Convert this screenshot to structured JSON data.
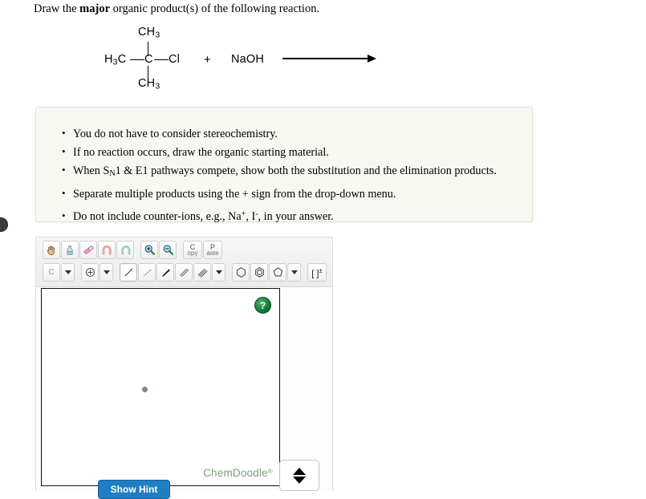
{
  "prompt": {
    "lead": "Draw the ",
    "bold": "major",
    "rest": " organic product(s) of the following reaction."
  },
  "reaction": {
    "left_methyl": "H3C",
    "center_atom": "C",
    "leaving_group": "Cl",
    "top_methyl": "CH3",
    "bottom_methyl": "CH3",
    "plus": "+",
    "reagent": "NaOH",
    "arrow_label": "",
    "structure_name": "2-chloro-2-methylpropane (tert-butyl chloride)"
  },
  "instructions": {
    "items": [
      "You do not have to consider stereochemistry.",
      "If no reaction occurs, draw the organic starting material.",
      "When SN1 & E1 pathways compete, show both the substitution and the elimination products.",
      "Separate multiple products using the + sign from the drop-down menu.",
      "Do not include counter-ions, e.g., Na+, I-, in your answer."
    ],
    "item3_parts": {
      "a": "When S",
      "sub": "N",
      "b": "1 & E1 pathways compete, show both the substitution and the elimination products."
    },
    "item5_parts": {
      "a": "Do not include counter-ions, e.g., Na",
      "sup1": "+",
      "b": ", I",
      "sup2": "-",
      "c": ", in your answer."
    }
  },
  "sketcher": {
    "toolbar_row1": [
      {
        "name": "hand-tool",
        "title": "Move / Pan"
      },
      {
        "name": "clear-tool",
        "title": "Clear"
      },
      {
        "name": "eraser-tool",
        "title": "Erase"
      },
      {
        "name": "undo-tool",
        "title": "Undo"
      },
      {
        "name": "redo-tool",
        "title": "Redo"
      },
      {
        "name": "zoom-in-tool",
        "title": "Zoom In"
      },
      {
        "name": "zoom-out-tool",
        "title": "Zoom Out"
      },
      {
        "name": "copy-tool",
        "title": "Copy"
      },
      {
        "name": "paste-tool",
        "title": "Paste"
      }
    ],
    "copy_label_top": "C",
    "copy_label_bottom": "opy",
    "paste_label_top": "P",
    "paste_label_bottom": "aste",
    "element_label": "C",
    "toolbar_row2": [
      {
        "name": "element-carbon-tool",
        "title": "Carbon"
      },
      {
        "name": "element-dropdown",
        "title": "More elements"
      },
      {
        "name": "charge-tool",
        "title": "Charge"
      },
      {
        "name": "charge-dropdown",
        "title": "More charges"
      },
      {
        "name": "single-bond-tool",
        "title": "Single bond",
        "selected": true
      },
      {
        "name": "hash-bond-tool",
        "title": "Hashed bond"
      },
      {
        "name": "wedge-bond-tool",
        "title": "Wedge bond"
      },
      {
        "name": "double-bond-tool",
        "title": "Double bond"
      },
      {
        "name": "triple-bond-tool",
        "title": "Triple bond"
      },
      {
        "name": "bond-dropdown",
        "title": "More bonds"
      },
      {
        "name": "cyclohexane-tool",
        "title": "Cyclohexane"
      },
      {
        "name": "benzene-tool",
        "title": "Benzene"
      },
      {
        "name": "cyclopentane-tool",
        "title": "Cyclopentane"
      },
      {
        "name": "ring-dropdown",
        "title": "More rings"
      },
      {
        "name": "bracket-charge-tool",
        "title": "Brackets / charge"
      }
    ],
    "bracket_label": "[ ]",
    "bracket_sup": "±",
    "help_label": "?",
    "watermark": "ChemDoodle",
    "watermark_sup": "®"
  },
  "buttons": {
    "show_hint": "Show Hint"
  },
  "colors": {
    "panel_bg": "#f8f8f2",
    "hint_button": "#1f7fc4",
    "help_green": "#0b6b2e",
    "watermark_green": "#7d9c7d"
  }
}
